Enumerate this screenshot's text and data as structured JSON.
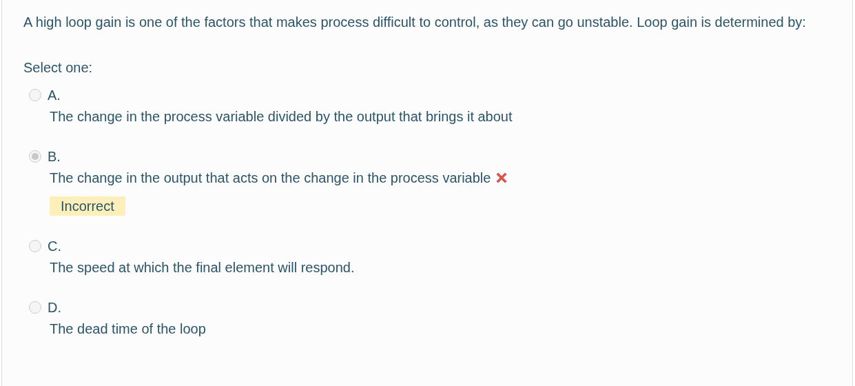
{
  "question": {
    "text": "A high loop gain is one of the factors that makes process difficult to control, as they can go unstable. Loop gain is determined by:",
    "prompt": "Select one:",
    "options": [
      {
        "letter": "A.",
        "text": "The change in the process variable divided by the output that brings it about",
        "selected": false
      },
      {
        "letter": "B.",
        "text": "The change in the output that acts on the change in the process variable",
        "selected": true,
        "kind": "incorrect",
        "feedback": "Incorrect"
      },
      {
        "letter": "C.",
        "text": "The speed at which the final element will respond.",
        "selected": false
      },
      {
        "letter": "D.",
        "text": "The dead time of the loop",
        "selected": false
      }
    ]
  }
}
